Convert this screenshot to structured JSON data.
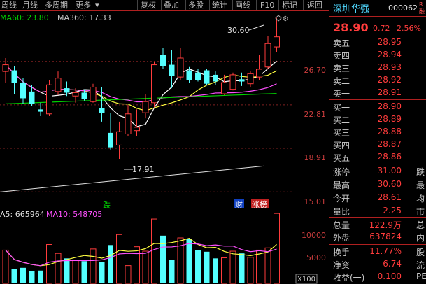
{
  "topbar": {
    "left_items": [
      "周线",
      "月线",
      "多周期",
      "更多"
    ],
    "right_items": [
      "复权",
      "叠加",
      "多股",
      "统计",
      "画线",
      "F10",
      "标记",
      "返回"
    ]
  },
  "indicators": {
    "ma60_label": "MA60: 23.80",
    "ma360_label": "MA360: 17.33",
    "vol_ma5_label": "A5: 665964",
    "vol_ma10_label": "MA10: 548705"
  },
  "price_axis": [
    "26.70",
    "22.81",
    "18.91",
    "15.01"
  ],
  "volume_axis": [
    "10000",
    "5000"
  ],
  "volume_unit": "X100",
  "annotations": {
    "high": "30.60",
    "low": "17.91",
    "tag_drop": "跌",
    "tag_fin": "财",
    "tag_rank": "涨榜"
  },
  "chart_data": {
    "type": "candlestick",
    "title": "",
    "candles": [
      {
        "o": 25.8,
        "h": 27.0,
        "l": 24.8,
        "c": 26.4
      },
      {
        "o": 25.9,
        "h": 26.3,
        "l": 23.8,
        "c": 24.8
      },
      {
        "o": 24.8,
        "h": 25.2,
        "l": 22.9,
        "c": 23.4
      },
      {
        "o": 24.0,
        "h": 24.6,
        "l": 22.7,
        "c": 22.9
      },
      {
        "o": 22.4,
        "h": 23.0,
        "l": 21.8,
        "c": 22.2
      },
      {
        "o": 22.0,
        "h": 25.0,
        "l": 21.8,
        "c": 24.6
      },
      {
        "o": 24.0,
        "h": 25.8,
        "l": 23.7,
        "c": 25.2
      },
      {
        "o": 24.3,
        "h": 24.9,
        "l": 23.6,
        "c": 23.9
      },
      {
        "o": 23.6,
        "h": 24.3,
        "l": 23.0,
        "c": 23.9
      },
      {
        "o": 23.9,
        "h": 24.2,
        "l": 23.2,
        "c": 23.3
      },
      {
        "o": 23.1,
        "h": 24.7,
        "l": 23.0,
        "c": 24.4
      },
      {
        "o": 22.5,
        "h": 24.4,
        "l": 21.3,
        "c": 22.1
      },
      {
        "o": 20.3,
        "h": 22.1,
        "l": 18.8,
        "c": 19.0
      },
      {
        "o": 19.2,
        "h": 21.3,
        "l": 17.91,
        "c": 20.4
      },
      {
        "o": 20.2,
        "h": 22.8,
        "l": 20.0,
        "c": 22.0
      },
      {
        "o": 20.5,
        "h": 22.4,
        "l": 20.0,
        "c": 20.8
      },
      {
        "o": 22.1,
        "h": 23.8,
        "l": 21.6,
        "c": 23.1
      },
      {
        "o": 23.0,
        "h": 26.7,
        "l": 22.6,
        "c": 26.4
      },
      {
        "o": 27.3,
        "h": 27.9,
        "l": 26.0,
        "c": 26.3
      },
      {
        "o": 26.4,
        "h": 27.7,
        "l": 24.3,
        "c": 25.4
      },
      {
        "o": 25.3,
        "h": 27.9,
        "l": 25.0,
        "c": 27.0
      },
      {
        "o": 25.9,
        "h": 26.2,
        "l": 24.8,
        "c": 25.0
      },
      {
        "o": 25.7,
        "h": 26.0,
        "l": 24.9,
        "c": 25.0
      },
      {
        "o": 25.9,
        "h": 26.0,
        "l": 24.6,
        "c": 24.7
      },
      {
        "o": 25.5,
        "h": 25.8,
        "l": 24.6,
        "c": 24.9
      },
      {
        "o": 23.8,
        "h": 25.5,
        "l": 23.7,
        "c": 24.8
      },
      {
        "o": 24.2,
        "h": 25.7,
        "l": 24.1,
        "c": 25.5
      },
      {
        "o": 25.1,
        "h": 25.7,
        "l": 24.5,
        "c": 24.9
      },
      {
        "o": 24.7,
        "h": 25.8,
        "l": 24.4,
        "c": 25.6
      },
      {
        "o": 25.3,
        "h": 27.3,
        "l": 25.0,
        "c": 26.0
      },
      {
        "o": 26.2,
        "h": 29.0,
        "l": 26.0,
        "c": 28.3
      },
      {
        "o": 28.0,
        "h": 30.6,
        "l": 27.5,
        "c": 28.9
      }
    ],
    "volumes": [
      6000,
      2600,
      2800,
      2200,
      2300,
      7000,
      5400,
      4500,
      4200,
      4000,
      6200,
      3800,
      6900,
      8800,
      3200,
      6600,
      5800,
      11600,
      8600,
      4200,
      8200,
      8000,
      6000,
      5700,
      4500,
      4600,
      5800,
      5400,
      4700,
      6000,
      6400,
      12600
    ],
    "ylim": [
      14.4,
      31.2
    ],
    "vol_ylim": [
      0,
      13500
    ]
  },
  "panel": {
    "name": "深圳华强",
    "code": "000062",
    "rzq": "R融",
    "price": "28.90",
    "change": "0.72",
    "change_pct": "2.56%",
    "sell": [
      {
        "label": "卖五",
        "price": "28.95"
      },
      {
        "label": "卖四",
        "price": "28.94"
      },
      {
        "label": "卖三",
        "price": "28.93"
      },
      {
        "label": "卖二",
        "price": "28.92"
      },
      {
        "label": "卖一",
        "price": "28.91"
      }
    ],
    "buy": [
      {
        "label": "买一",
        "price": "28.90"
      },
      {
        "label": "买二",
        "price": "28.89"
      },
      {
        "label": "买三",
        "price": "28.88"
      },
      {
        "label": "买四",
        "price": "28.87"
      },
      {
        "label": "买五",
        "price": "28.86"
      }
    ],
    "stats1": [
      {
        "label": "涨停",
        "value": "31.00",
        "right": "跌"
      },
      {
        "label": "最高",
        "value": "30.60",
        "right": "最"
      },
      {
        "label": "今开",
        "value": "28.61",
        "right": "均"
      },
      {
        "label": "量比",
        "value": "2.25",
        "right": "市"
      }
    ],
    "stats2": [
      {
        "label": "总量",
        "value": "122.9万",
        "right": "总"
      },
      {
        "label": "外盘",
        "value": "637824",
        "right": "内"
      }
    ],
    "stats3": [
      {
        "label": "换手",
        "value": "11.77%",
        "right": "股"
      },
      {
        "label": "净资",
        "value": "6.74",
        "right": "流"
      },
      {
        "label": "收益(一)",
        "value": "0.100",
        "right": "PE"
      }
    ]
  }
}
